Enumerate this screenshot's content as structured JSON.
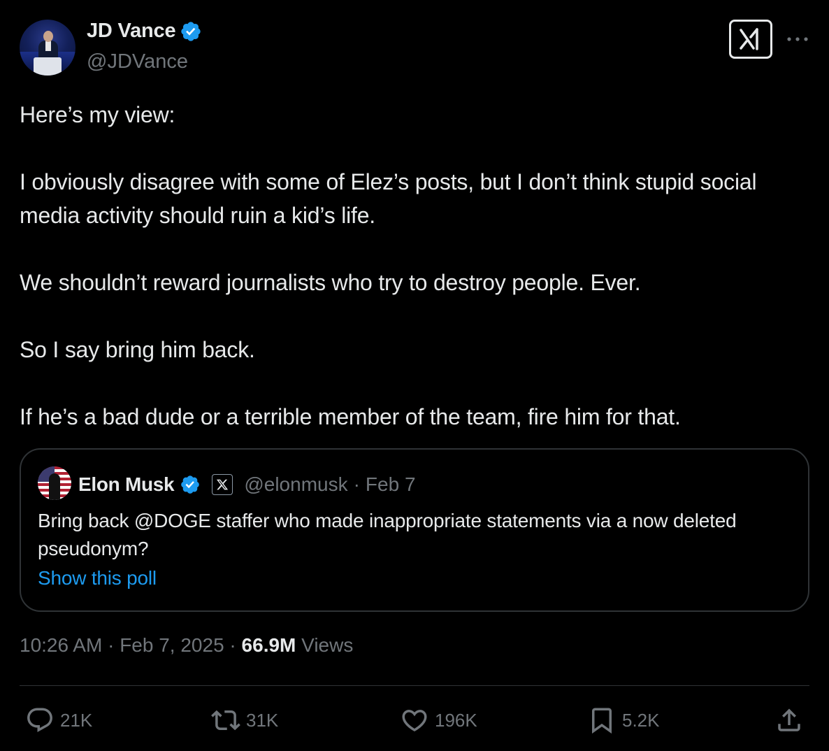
{
  "author": {
    "display_name": "JD Vance",
    "handle": "@JDVance",
    "verified": true,
    "avatar_icon": "jd-vance-avatar"
  },
  "header_actions": {
    "grok_icon": "grok-icon",
    "more_icon": "more-dots-icon"
  },
  "tweet": {
    "paragraphs": [
      "Here’s my view:",
      "I obviously disagree with some of Elez’s posts, but I don’t think stupid social media activity should ruin a kid’s life.",
      "We shouldn’t reward journalists who try to destroy people. Ever.",
      "So I say bring him back.",
      "If he’s a bad dude or a terrible member of the team, fire him for that."
    ]
  },
  "quote": {
    "display_name": "Elon Musk",
    "verified": true,
    "affiliation_icon": "x-logo-icon",
    "handle": "@elonmusk",
    "separator": "·",
    "date": "Feb 7",
    "text": "Bring back @DOGE staffer who made inappropriate statements via a now deleted pseudonym?",
    "poll_link": "Show this poll"
  },
  "meta": {
    "time": "10:26 AM",
    "separator": " · ",
    "date": "Feb 7, 2025",
    "views_count": "66.9M",
    "views_label": " Views"
  },
  "actions": {
    "replies": "21K",
    "reposts": "31K",
    "likes": "196K",
    "bookmarks": "5.2K"
  },
  "colors": {
    "background": "#000000",
    "text_primary": "#e7e9ea",
    "text_secondary": "#71767b",
    "link": "#1d9bf0",
    "verified": "#1d9bf0",
    "border": "#2f3336"
  }
}
